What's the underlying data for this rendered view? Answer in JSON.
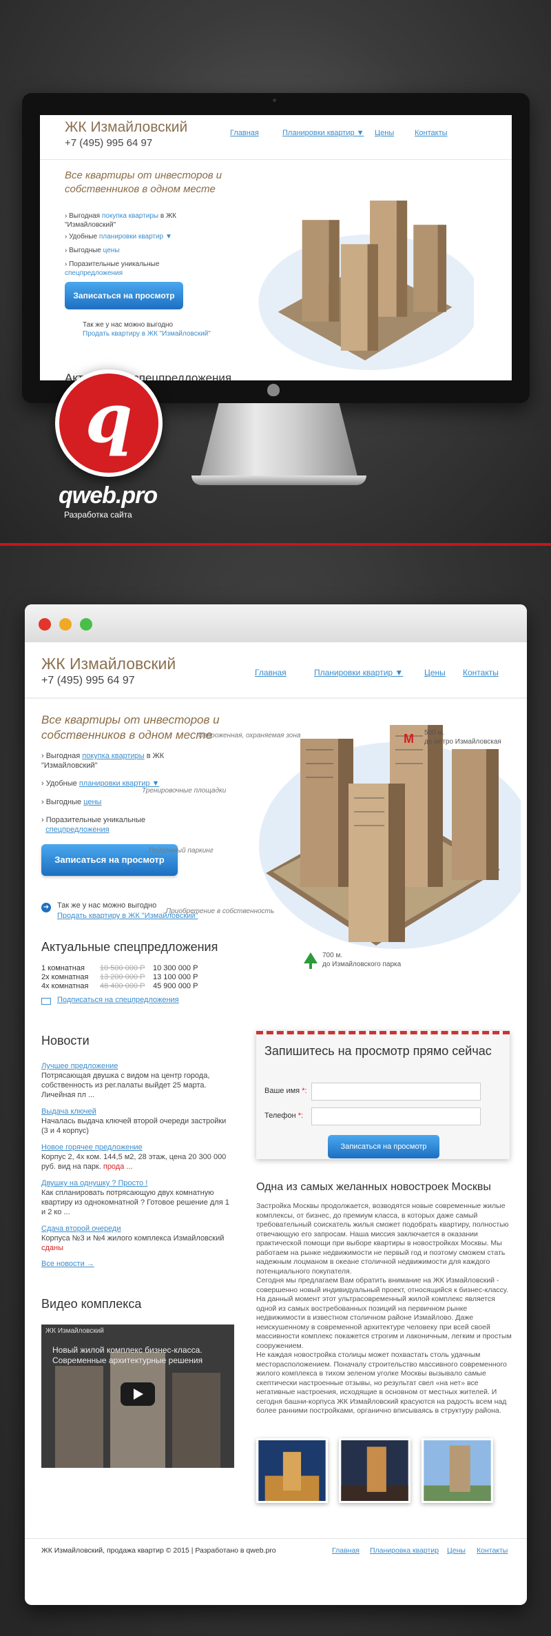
{
  "site": {
    "title": "ЖК Измайловский",
    "phone": "+7 (495) 995 64 97",
    "nav": [
      "Главная",
      "Планировки квартир ▼",
      "Цены",
      "Контакты"
    ],
    "tagline": "Все квартиры от инвесторов и собственников в одном месте",
    "features": [
      {
        "prefix": "› Выгодная ",
        "link": "покупка квартиры",
        "suffix": " в ЖК \"Измайловский\""
      },
      {
        "prefix": "› Удобные ",
        "link": "планировки квартир ▼",
        "suffix": ""
      },
      {
        "prefix": "› Выгодные ",
        "link": "цены",
        "suffix": ""
      },
      {
        "prefix": "› Поразительные уникальные ",
        "link": "спецпредложения",
        "suffix": ""
      }
    ],
    "cta_button": "Записаться на просмотр",
    "sell_note": "Так же у нас можно выгодно",
    "sell_link": "Продать квартиру в ЖК \"Измайловский\"",
    "annotations": {
      "fence": "Огороженная, охраняемая зона",
      "playground": "Тренировочные площадки",
      "parking": "Подземный паркинг",
      "purchase": "Приобретение в собственность"
    },
    "metro": {
      "distance": "500 м.",
      "label": "до метро Измайловская"
    },
    "park": {
      "distance": "700 м.",
      "label": "до Измайловского парка"
    },
    "actual_title": "Актуальные спецпредложения",
    "offers": [
      {
        "rooms": "1 комнатная",
        "old": "10 500 000 Р",
        "new": "10 300 000 Р"
      },
      {
        "rooms": "2х комнатная",
        "old": "13 200 000 Р",
        "new": "13 100 000 Р"
      },
      {
        "rooms": "4х комнатная",
        "old": "48 400 000 Р",
        "new": "45 900 000 Р"
      }
    ],
    "subscribe": "Подписаться на спецпредложения",
    "news_title": "Новости",
    "news": [
      {
        "link": "Лучшее предложение",
        "text": "Потрясающая двушка с видом на центр города, собственность из рег.палаты выйдет 25 марта. Личейная пл ...",
        "extra": ""
      },
      {
        "link": "Выдача ключей",
        "text": "Началась выдача ключей второй очереди застройки (3 и 4 корпус)",
        "extra": ""
      },
      {
        "link": "Новое горячее предложение",
        "text": "Корпус 2, 4х ком. 144,5 м2, 28 этаж, цена 20 300 000 руб. вид на парк. ",
        "extra": "продa ..."
      },
      {
        "link": "Двушку на однушку ? Просто !",
        "text": "Как спланировать потрясающую двух комнатную квартиру из однокомнатной ? Готовое решение для 1 и 2 ко ...",
        "extra": ""
      },
      {
        "link": "Сдача второй очереди",
        "text": "Корпуса №3 и №4 жилого комплекса Измайловский ",
        "extra": "сданы"
      }
    ],
    "all_news": "Все новости →",
    "form": {
      "title": "Запишитесь на просмотр прямо сейчас",
      "name_label": "Ваше имя",
      "phone_label": "Телефон",
      "required": "*:",
      "button": "Записаться на просмотр"
    },
    "seo_title": "Одна из самых желанных новостроек Москвы",
    "seo_paragraphs": [
      "Застройка Москвы продолжается, возводятся новые современные жилые комплексы, от бизнес, до премиум класса, в которых даже самый требовательный соискатель жилья сможет подобрать квартиру, полностью отвечающую его запросам. Наша миссия заключается в оказании практической помощи при выборе квартиры в новостройках Москвы. Мы работаем на рынке недвижимости не первый год и поэтому сможем стать надежным лоцманом в океане столичной недвижимости для каждого потенциального покупателя.",
      "Сегодня мы предлагаем Вам обратить внимание на ЖК Измайловский - совершенно новый индивидуальный проект, относящийся к бизнес-классу. На данный момент этот ультрасовременный жилой комплекс является одной из самых востребованных позиций на первичном рынке недвижимости в известном столичном районе Измайлово. Даже неискушенному в современной архитектуре человеку при всей своей массивности комплекс покажется строгим и лаконичным, легким и простым сооружением.",
      "Не каждая новостройка столицы может похвастать столь удачным месторасположением. Поначалу строительство массивного современного жилого комплекса в тихом зеленом уголке Москвы вызывало самые скептически настроенные отзывы, но результат свел «на нет» все негативные настроения, исходящие в основном от местных жителей. И сегодня башни-корпуса ЖК Измайловский красуются на радость всем над более ранними постройками, органично вписываясь в структуру района."
    ],
    "video_title": "Видео комплекса",
    "video_label": "ЖК Измайловский",
    "video_overlay": "Новый жилой комплекс бизнес-класса. Современные архитектурные решения",
    "footer_text": "ЖК Измайловский, продажа квартир © 2015 | Разработано в qweb.pro",
    "footer_nav": [
      "Главная",
      "Планировка квартир",
      "Цены",
      "Контакты"
    ]
  },
  "brand": {
    "logo_letter": "q",
    "name": "qweb.pro",
    "subtitle": "Разработка сайта"
  },
  "colors": {
    "accent_red": "#d41e22",
    "link_blue": "#3a8ccc",
    "title_brown": "#8a7051",
    "button_blue": "#1d6fc0"
  }
}
